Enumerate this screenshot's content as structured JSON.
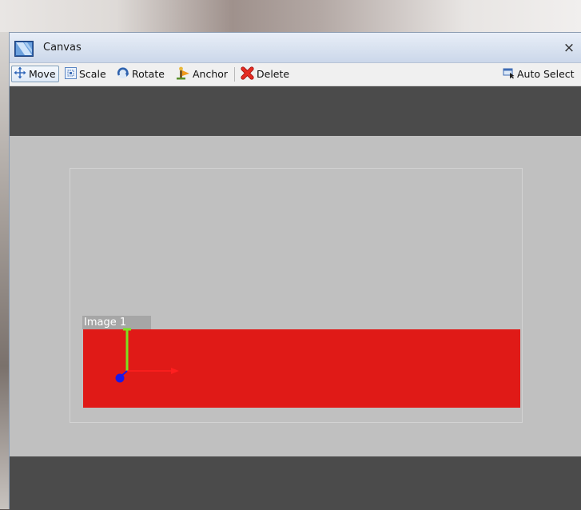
{
  "window": {
    "title": "Canvas",
    "close_glyph": "×"
  },
  "toolbar": {
    "move_label": "Move",
    "scale_label": "Scale",
    "rotate_label": "Rotate",
    "anchor_label": "Anchor",
    "delete_label": "Delete",
    "auto_select_label": "Auto Select"
  },
  "canvas": {
    "object_label": "Image 1",
    "object_color": "#e01a17",
    "background_color": "#c0c0c0",
    "letterbox_color": "#4b4b4b"
  },
  "icons": {
    "window": "canvas-window-icon",
    "move": "move-arrows-icon",
    "scale": "scale-icon",
    "rotate": "rotate-icon",
    "anchor": "anchor-icon",
    "delete": "delete-x-icon",
    "auto_select": "auto-select-icon",
    "gizmo": "transform-gizmo"
  },
  "colors": {
    "gizmo_x_axis": "#ff1f1f",
    "gizmo_y_axis": "#7ee020",
    "gizmo_pivot": "#1818e8"
  }
}
